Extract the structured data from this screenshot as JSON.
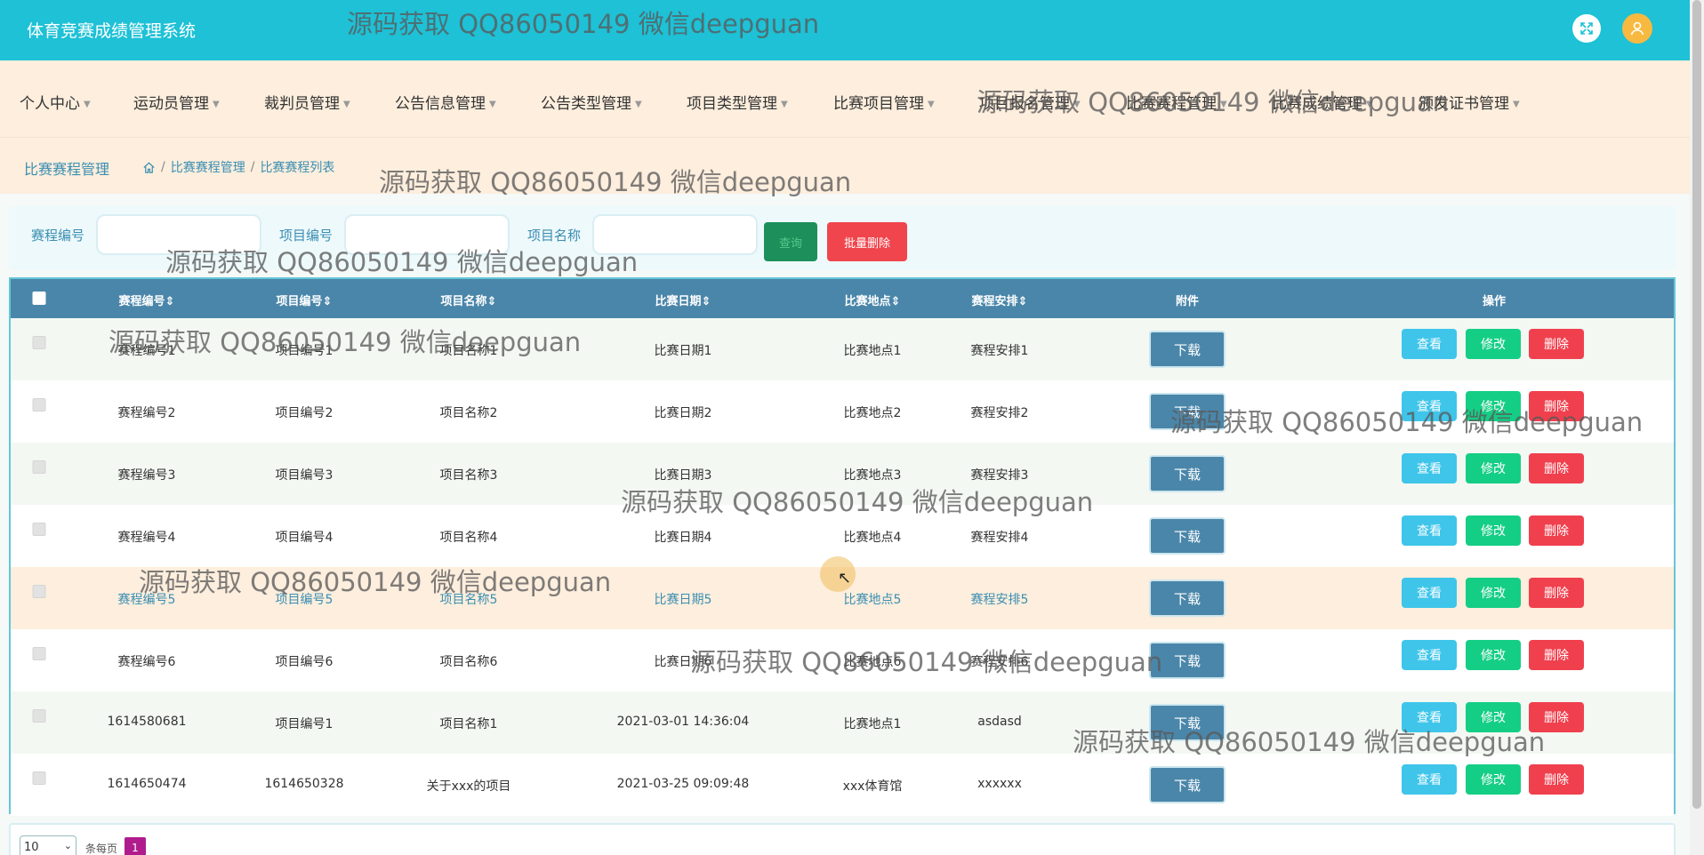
{
  "app": {
    "title": "体育竞赛成绩管理系统",
    "fullscreen_icon": "expand-icon",
    "avatar_icon": "user-icon"
  },
  "nav": {
    "items": [
      {
        "label": "个人中心"
      },
      {
        "label": "运动员管理"
      },
      {
        "label": "裁判员管理"
      },
      {
        "label": "公告信息管理"
      },
      {
        "label": "公告类型管理"
      },
      {
        "label": "项目类型管理"
      },
      {
        "label": "比赛项目管理"
      },
      {
        "label": "项目报名管理"
      },
      {
        "label": "比赛赛程管理"
      },
      {
        "label": "比赛成绩管理"
      },
      {
        "label": "颁发证书管理"
      }
    ]
  },
  "breadcrumb": {
    "title": "比赛赛程管理",
    "home_icon": "home-icon",
    "items": [
      "比赛赛程管理",
      "比赛赛程列表"
    ]
  },
  "search": {
    "field1_label": "赛程编号",
    "field2_label": "项目编号",
    "field3_label": "项目名称",
    "search_button": "查询",
    "batch_delete_button": "批量删除"
  },
  "table": {
    "headers": {
      "code": "赛程编号",
      "project_code": "项目编号",
      "project_name": "项目名称",
      "date": "比赛日期",
      "place": "比赛地点",
      "arrangement": "赛程安排",
      "attachment": "附件",
      "actions": "操作"
    },
    "download_label": "下载",
    "view_label": "查看",
    "edit_label": "修改",
    "delete_label": "删除",
    "rows": [
      {
        "code": "赛程编号1",
        "project_code": "项目编号1",
        "project_name": "项目名称1",
        "date": "比赛日期1",
        "place": "比赛地点1",
        "arrangement": "赛程安排1"
      },
      {
        "code": "赛程编号2",
        "project_code": "项目编号2",
        "project_name": "项目名称2",
        "date": "比赛日期2",
        "place": "比赛地点2",
        "arrangement": "赛程安排2"
      },
      {
        "code": "赛程编号3",
        "project_code": "项目编号3",
        "project_name": "项目名称3",
        "date": "比赛日期3",
        "place": "比赛地点3",
        "arrangement": "赛程安排3"
      },
      {
        "code": "赛程编号4",
        "project_code": "项目编号4",
        "project_name": "项目名称4",
        "date": "比赛日期4",
        "place": "比赛地点4",
        "arrangement": "赛程安排4"
      },
      {
        "code": "赛程编号5",
        "project_code": "项目编号5",
        "project_name": "项目名称5",
        "date": "比赛日期5",
        "place": "比赛地点5",
        "arrangement": "赛程安排5"
      },
      {
        "code": "赛程编号6",
        "project_code": "项目编号6",
        "project_name": "项目名称6",
        "date": "比赛日期6",
        "place": "比赛地点6",
        "arrangement": "赛程安排6"
      },
      {
        "code": "1614580681",
        "project_code": "项目编号1",
        "project_name": "项目名称1",
        "date": "2021-03-01 14:36:04",
        "place": "比赛地点1",
        "arrangement": "asdasd"
      },
      {
        "code": "1614650474",
        "project_code": "1614650328",
        "project_name": "关于xxx的项目",
        "date": "2021-03-25 09:09:48",
        "place": "xxx体育馆",
        "arrangement": "xxxxxx"
      }
    ]
  },
  "pager": {
    "page_size": "10",
    "per_page_label": "条每页",
    "current_page": "1"
  },
  "watermark": "源码获取 QQ86050149 微信deepguan"
}
